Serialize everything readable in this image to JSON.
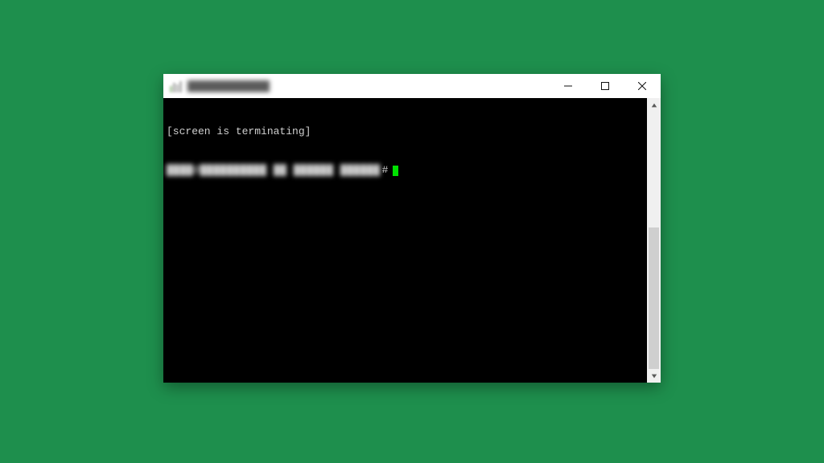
{
  "window": {
    "title_obscured": "████████████",
    "controls": {
      "minimize": "Minimize",
      "maximize": "Maximize",
      "close": "Close"
    }
  },
  "terminal": {
    "line1": "[screen is terminating]",
    "prompt_obscured": "████@██████████ ██ ██████ ██████",
    "prompt_symbol": "#",
    "cursor_color": "#00e000"
  }
}
